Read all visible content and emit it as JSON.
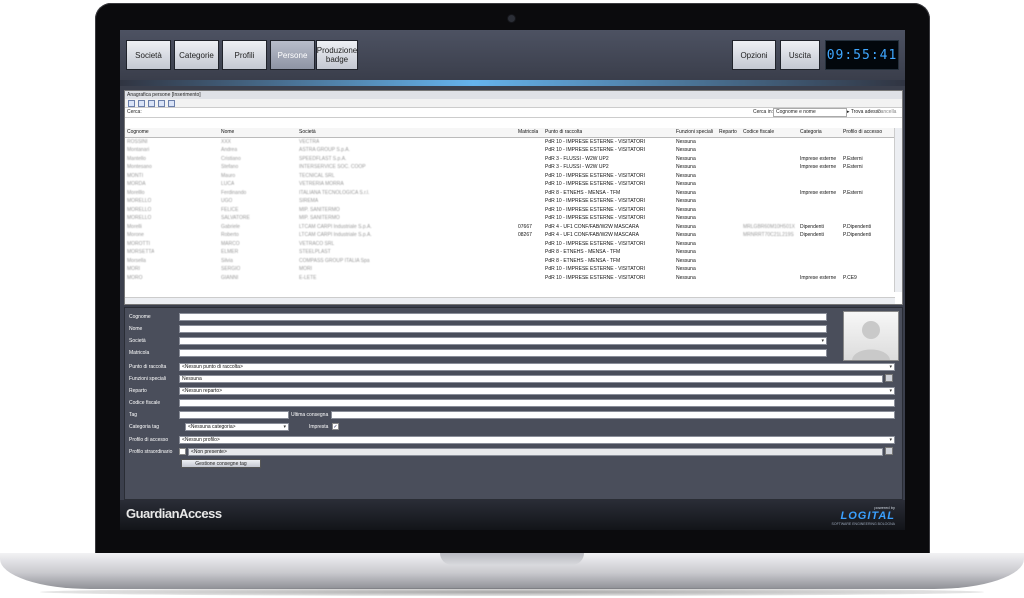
{
  "nav": {
    "societa": "Società",
    "categorie": "Categorie",
    "profili": "Profili",
    "persone": "Persone",
    "produzione_badge": "Produzione badge",
    "opzioni": "Opzioni",
    "uscita": "Uscita"
  },
  "clock": "09:55:41",
  "panel": {
    "title": "Anagrafica persone [Inserimento]",
    "search_label": "Cerca:",
    "search_in_label": "Cerca in:",
    "search_in_value": "Cognome e nome",
    "find_now": "Trova adesso",
    "cancel": "Cancella"
  },
  "table": {
    "columns": [
      "Cognome",
      "Nome",
      "Società",
      "Matricola",
      "Punto di raccolta",
      "Funzioni speciali",
      "Reparto",
      "Codice fiscale",
      "Categoria",
      "Profilo di accesso"
    ],
    "rows": [
      {
        "cognome": "ROSSINI",
        "nome": "XXX",
        "societa": "VECTRA",
        "matricola": "",
        "punto": "PdR 10 - IMPRESE ESTERNE - VISITATORI",
        "funzioni": "Nessuna",
        "codice": "",
        "categoria": "",
        "profilo": ""
      },
      {
        "cognome": "Montanari",
        "nome": "Andrea",
        "societa": "ASTRA GROUP S.p.A.",
        "matricola": "",
        "punto": "PdR 10 - IMPRESE ESTERNE - VISITATORI",
        "funzioni": "Nessuna",
        "codice": "",
        "categoria": "",
        "profilo": ""
      },
      {
        "cognome": "Mantello",
        "nome": "Cristiano",
        "societa": "SPEEDFLAST S.p.A.",
        "matricola": "",
        "punto": "PdR 3 - FLUSSI - W2W UP2",
        "funzioni": "Nessuna",
        "codice": "",
        "categoria": "Imprese esterne",
        "profilo": "P.Esterni"
      },
      {
        "cognome": "Montesano",
        "nome": "Stefano",
        "societa": "INTERSERVICE SOC. COOP",
        "matricola": "",
        "punto": "PdR 3 - FLUSSI - W2W UP2",
        "funzioni": "Nessuna",
        "codice": "",
        "categoria": "Imprese esterne",
        "profilo": "P.Esterni"
      },
      {
        "cognome": "MONTI",
        "nome": "Mauro",
        "societa": "TECNICAL SRL",
        "matricola": "",
        "punto": "PdR 10 - IMPRESE ESTERNE - VISITATORI",
        "funzioni": "Nessuna",
        "codice": "",
        "categoria": "",
        "profilo": ""
      },
      {
        "cognome": "MORDA",
        "nome": "LUCA",
        "societa": "VETRERIA MORRA",
        "matricola": "",
        "punto": "PdR 10 - IMPRESE ESTERNE - VISITATORI",
        "funzioni": "Nessuna",
        "codice": "",
        "categoria": "",
        "profilo": ""
      },
      {
        "cognome": "Morelllo",
        "nome": "Ferdinando",
        "societa": "ITALIANA TECNOLOGICA S.r.l.",
        "matricola": "",
        "punto": "PdR 8 - ETNEHS - MENSA - TFM",
        "funzioni": "Nessuna",
        "codice": "",
        "categoria": "Imprese esterne",
        "profilo": "P.Esterni"
      },
      {
        "cognome": "MORELLO",
        "nome": "UGO",
        "societa": "SIREMA",
        "matricola": "",
        "punto": "PdR 10 - IMPRESE ESTERNE - VISITATORI",
        "funzioni": "Nessuna",
        "codice": "",
        "categoria": "",
        "profilo": ""
      },
      {
        "cognome": "MORELLO",
        "nome": "FELICE",
        "societa": "MIP. SANITERMO",
        "matricola": "",
        "punto": "PdR 10 - IMPRESE ESTERNE - VISITATORI",
        "funzioni": "Nessuna",
        "codice": "",
        "categoria": "",
        "profilo": ""
      },
      {
        "cognome": "MORELLO",
        "nome": "SALVATORE",
        "societa": "MIP. SANITERMO",
        "matricola": "",
        "punto": "PdR 10 - IMPRESE ESTERNE - VISITATORI",
        "funzioni": "Nessuna",
        "codice": "",
        "categoria": "",
        "profilo": ""
      },
      {
        "cognome": "Morelli",
        "nome": "Gabriele",
        "societa": "LTCAM CARPI Industriale S.p.A.",
        "matricola": "07667",
        "punto": "PdR 4 - UF1 CONF/FAB/W2W MASCARA",
        "funzioni": "Nessuna",
        "codice": "MRLGBR60M10H501X",
        "categoria": "Dipendenti",
        "profilo": "P.Dipendenti"
      },
      {
        "cognome": "Morone",
        "nome": "Roberto",
        "societa": "LTCAM CARPI Industriale S.p.A.",
        "matricola": "08267",
        "punto": "PdR 4 - UF1 CONF/FAB/W2W MASCARA",
        "funzioni": "Nessuna",
        "codice": "MRNRRT70C21L219S",
        "categoria": "Dipendenti",
        "profilo": "P.Dipendenti"
      },
      {
        "cognome": "MOROTTI",
        "nome": "MARCO",
        "societa": "VETRACO SRL",
        "matricola": "",
        "punto": "PdR 10 - IMPRESE ESTERNE - VISITATORI",
        "funzioni": "Nessuna",
        "codice": "",
        "categoria": "",
        "profilo": ""
      },
      {
        "cognome": "MORSETTA",
        "nome": "ELMER",
        "societa": "STEELPLAST",
        "matricola": "",
        "punto": "PdR 8 - ETNEHS - MENSA - TFM",
        "funzioni": "Nessuna",
        "codice": "",
        "categoria": "",
        "profilo": ""
      },
      {
        "cognome": "Morsella",
        "nome": "Silvia",
        "societa": "COMPASS GROUP ITALIA Spa",
        "matricola": "",
        "punto": "PdR 8 - ETNEHS - MENSA - TFM",
        "funzioni": "Nessuna",
        "codice": "",
        "categoria": "",
        "profilo": ""
      },
      {
        "cognome": "MORI",
        "nome": "SERGIO",
        "societa": "MORI",
        "matricola": "",
        "punto": "PdR 10 - IMPRESE ESTERNE - VISITATORI",
        "funzioni": "Nessuna",
        "codice": "",
        "categoria": "",
        "profilo": ""
      },
      {
        "cognome": "MORO",
        "nome": "GIANNI",
        "societa": "E-LETE",
        "matricola": "",
        "punto": "PdR 10 - IMPRESE ESTERNE - VISITATORI",
        "funzioni": "Nessuna",
        "codice": "",
        "categoria": "Imprese esterne",
        "profilo": "P.CE9"
      }
    ]
  },
  "form": {
    "cognome": "Cognome",
    "nome": "Nome",
    "societa": "Società",
    "matricola": "Matricola",
    "punto_label": "Punto di raccolta",
    "punto_value": "<Nessun punto di raccolta>",
    "funzioni_label": "Funzioni speciali",
    "funzioni_value": "Nessuna",
    "reparto_label": "Reparto",
    "reparto_value": "<Nessun reparto>",
    "codice_label": "Codice fiscale",
    "tag_label": "Tag",
    "ultima_label": "Ultima consegna",
    "categoria_label": "Categoria tag",
    "categoria_value": "<Nessuna categoria>",
    "impresta_label": "Impresta",
    "profilo_label": "Profilo di accesso",
    "profilo_value": "<Nessun profilo>",
    "straord_label": "Profilo straordinario",
    "straord_value": "<Non presente>",
    "gestione_button": "Gestione consegne tag"
  },
  "brand": "GuardianAccess",
  "vendor": {
    "powered_by": "powered by",
    "name": "LOGITAL",
    "tagline": "SOFTWARE ENGINEERING BOLOGNA"
  }
}
